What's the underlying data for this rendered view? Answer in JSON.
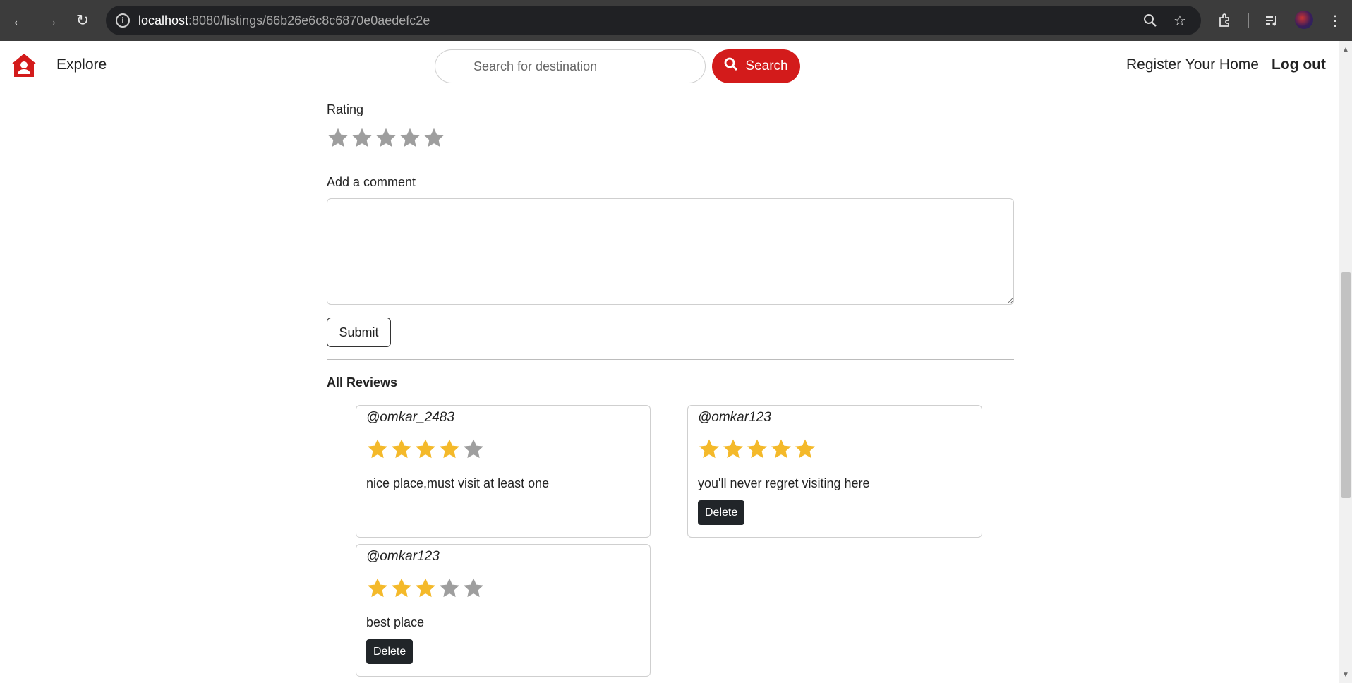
{
  "browser": {
    "url_host": "localhost",
    "url_rest": ":8080/listings/66b26e6c8c6870e0aedefc2e"
  },
  "navbar": {
    "explore_label": "Explore",
    "search_placeholder": "Search for destination",
    "search_button_label": "Search",
    "register_label": "Register Your Home",
    "logout_label": "Log out",
    "brand_color": "#d31b1b"
  },
  "review_form": {
    "rating_label": "Rating",
    "rating_value": 0,
    "comment_label": "Add a comment",
    "comment_value": "",
    "submit_label": "Submit"
  },
  "reviews": {
    "heading": "All Reviews",
    "items": [
      {
        "author": "@omkar_2483",
        "rating": 4,
        "comment": "nice place,must visit at least one",
        "delete_label": ""
      },
      {
        "author": "@omkar123",
        "rating": 5,
        "comment": "you'll never regret visiting here",
        "delete_label": "Delete"
      },
      {
        "author": "@omkar123",
        "rating": 3,
        "comment": "best place",
        "delete_label": "Delete"
      }
    ]
  },
  "colors": {
    "star_filled": "#f4b92a",
    "star_empty": "#9e9e9e",
    "accent": "#d31b1b"
  }
}
